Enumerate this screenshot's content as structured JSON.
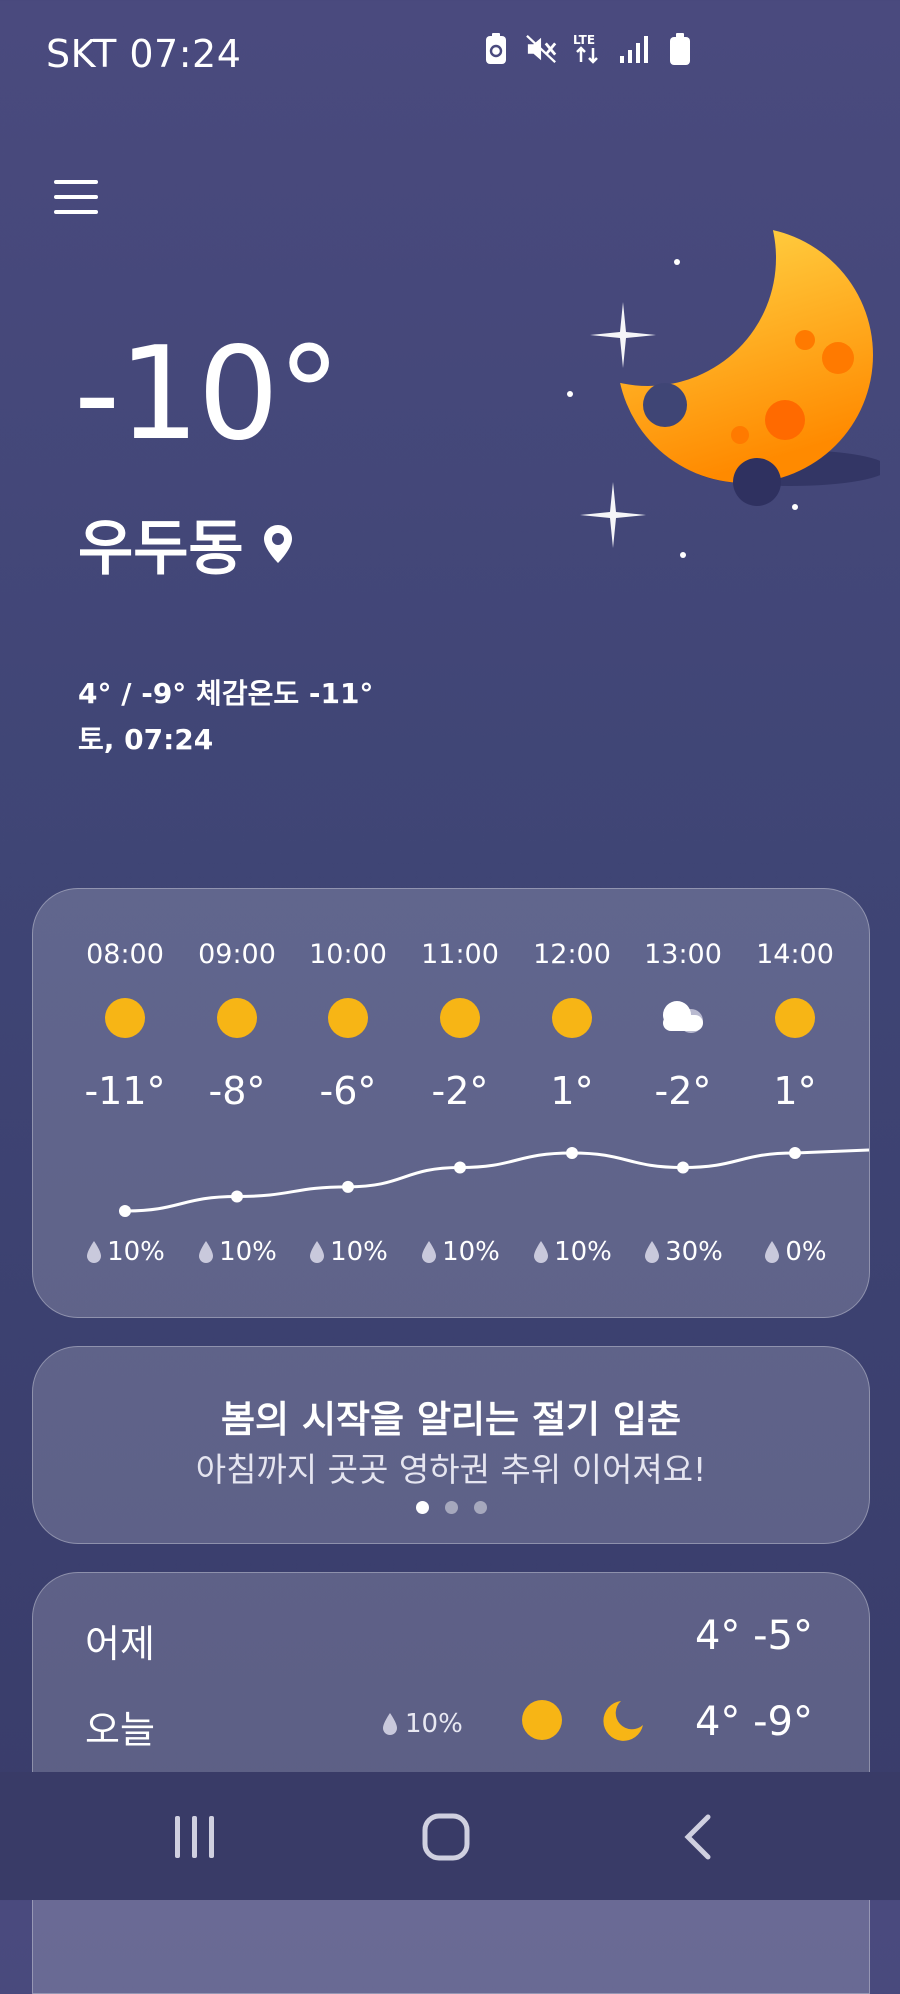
{
  "status_bar": {
    "carrier_time": "SKT 07:24",
    "icons": [
      "battery-saver-icon",
      "mute-icon",
      "lte-icon",
      "signal-icon",
      "battery-icon"
    ]
  },
  "current": {
    "temperature": "-10°",
    "location": "우두동",
    "hilo_feels": "4° / -9° 체감온도 -11°",
    "datetime": "토, 07:24",
    "icon": "crescent-moon-with-stars"
  },
  "hourly": [
    {
      "time": "08:00",
      "temp": "-11°",
      "rain": "10%",
      "icon": "sun-icon",
      "t": -11
    },
    {
      "time": "09:00",
      "temp": "-8°",
      "rain": "10%",
      "icon": "sun-icon",
      "t": -8
    },
    {
      "time": "10:00",
      "temp": "-6°",
      "rain": "10%",
      "icon": "sun-icon",
      "t": -6
    },
    {
      "time": "11:00",
      "temp": "-2°",
      "rain": "10%",
      "icon": "sun-icon",
      "t": -2
    },
    {
      "time": "12:00",
      "temp": "1°",
      "rain": "10%",
      "icon": "sun-icon",
      "t": 1
    },
    {
      "time": "13:00",
      "temp": "-2°",
      "rain": "30%",
      "icon": "cloudy-icon",
      "t": -2
    },
    {
      "time": "14:00",
      "temp": "1°",
      "rain": "0%",
      "icon": "sun-icon",
      "t": 1
    }
  ],
  "banner": {
    "title": "봄의 시작을 알리는 절기 입춘",
    "subtitle": "아침까지 곳곳 영하권 추위 이어져요!",
    "pages": 3,
    "active_page": 1
  },
  "daily": [
    {
      "label": "어제",
      "temps": "4° -5°"
    },
    {
      "label": "오늘",
      "rain": "10%",
      "temps": "4° -9°"
    }
  ],
  "colors": {
    "sun": "#f7b515",
    "bg_top": "#4a4a7e",
    "bg_bottom": "#393c6a"
  }
}
